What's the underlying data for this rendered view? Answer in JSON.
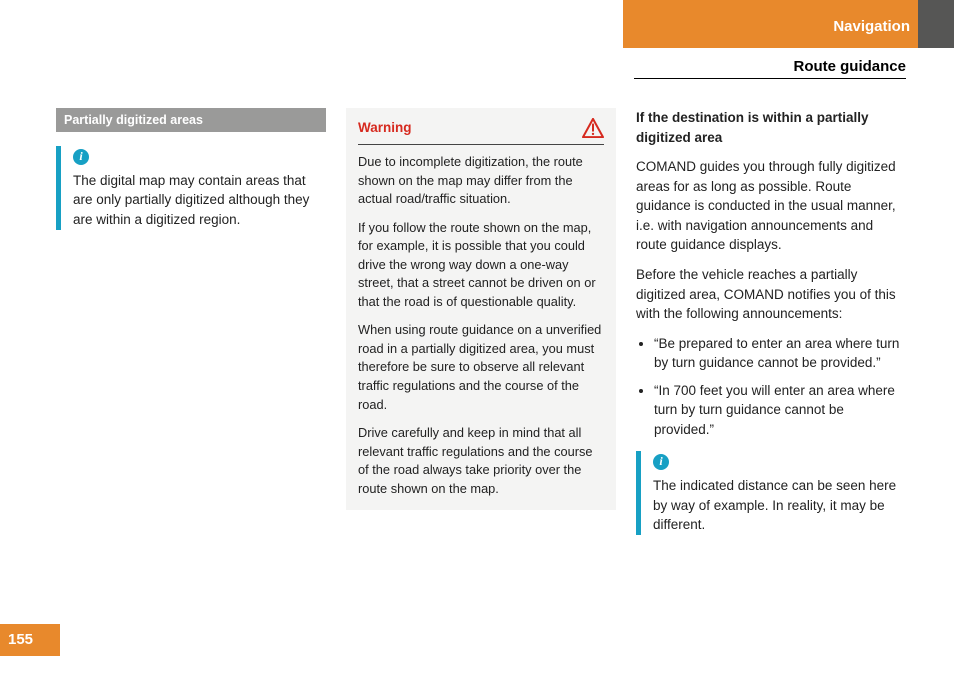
{
  "header": {
    "chapter": "Navigation",
    "section": "Route guidance"
  },
  "col1": {
    "section_label": "Partially digitized areas",
    "note": "The digital map may contain areas that are only partially digitized although they are within a digitized region."
  },
  "col2": {
    "warning_label": "Warning",
    "p1": "Due to incomplete digitization, the route shown on the map may differ from the actual road/traffic situation.",
    "p2": "If you follow the route shown on the map, for example, it is possible that you could drive the wrong way down a one-way street, that a street cannot be driven on or that the road is of questionable quality.",
    "p3": "When using route guidance on a unverified road in a partially digitized area, you must therefore be sure to observe all relevant traffic regulations and the course of the road.",
    "p4": "Drive carefully and keep in mind that all relevant traffic regulations and the course of the road always take priority over the route shown on the map."
  },
  "col3": {
    "heading": "If the destination is within a partially digitized area",
    "p1": "COMAND guides you through fully digitized areas for as long as possible. Route guidance is conducted in the usual manner, i.e. with navigation announcements and route guidance displays.",
    "p2": "Before the vehicle reaches a partially digitized area, COMAND notifies you of this with the following announcements:",
    "bullets": [
      "“Be prepared to enter an area where turn by turn guidance cannot be provided.”",
      "“In 700 feet you will enter an area where turn by turn guidance cannot be provided.”"
    ],
    "note": "The indicated distance can be seen here by way of example. In reality, it may be different."
  },
  "page_number": "155"
}
